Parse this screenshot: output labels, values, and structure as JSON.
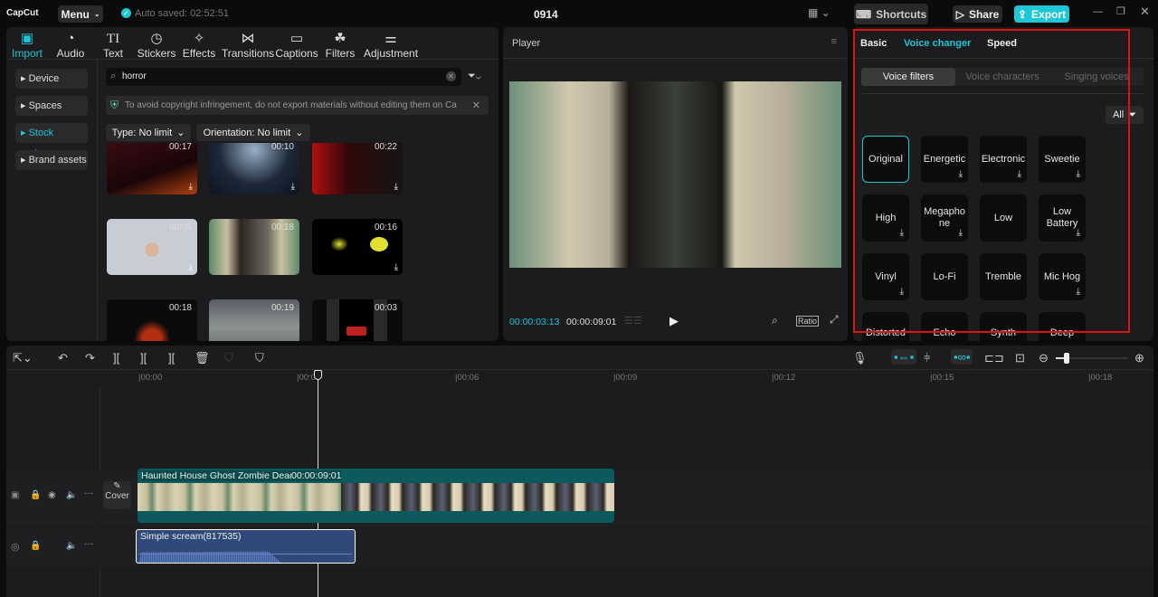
{
  "titlebar": {
    "logo": "CapCut",
    "menu": "Menu",
    "autosave": "Auto saved: 02:52:51",
    "project": "0914",
    "shortcuts": "Shortcuts",
    "share": "Share",
    "export": "Export"
  },
  "tabs": [
    {
      "label": "Import",
      "icon": "import-icon"
    },
    {
      "label": "Audio",
      "icon": "audio-icon"
    },
    {
      "label": "Text",
      "icon": "text-icon"
    },
    {
      "label": "Stickers",
      "icon": "stickers-icon"
    },
    {
      "label": "Effects",
      "icon": "effects-icon"
    },
    {
      "label": "Transitions",
      "icon": "transitions-icon"
    },
    {
      "label": "Captions",
      "icon": "captions-icon"
    },
    {
      "label": "Filters",
      "icon": "filters-icon"
    },
    {
      "label": "Adjustment",
      "icon": "adjustment-icon"
    }
  ],
  "sidebar": [
    {
      "label": "Device"
    },
    {
      "label": "Spaces"
    },
    {
      "label": "Stock mater..."
    },
    {
      "label": "Brand assets"
    }
  ],
  "search": {
    "value": "horror"
  },
  "notice": "To avoid copyright infringement, do not export materials without editing them on Ca",
  "filters": {
    "type": "Type: No limit",
    "orientation": "Orientation: No limit"
  },
  "media": [
    {
      "duration": "00:17"
    },
    {
      "duration": "00:10"
    },
    {
      "duration": "00:22"
    },
    {
      "duration": "00:09"
    },
    {
      "duration": "00:18"
    },
    {
      "duration": "00:16"
    },
    {
      "duration": "00:18"
    },
    {
      "duration": "00:19"
    },
    {
      "duration": "00:03"
    }
  ],
  "player": {
    "title": "Player",
    "current": "00:00:03:13",
    "total": "00:00:09:01",
    "ratio": "Ratio"
  },
  "right": {
    "tabs": [
      "Basic",
      "Voice changer",
      "Speed"
    ],
    "subtabs": [
      "Voice filters",
      "Voice characters",
      "Singing voices"
    ],
    "all": "All",
    "filters": [
      "Original",
      "Energetic",
      "Electronic",
      "Sweetie",
      "High",
      "Megaphone",
      "Low",
      "Low Battery",
      "Vinyl",
      "Lo-Fi",
      "Tremble",
      "Mic Hog",
      "Distorted",
      "Echo",
      "Synth",
      "Deep"
    ]
  },
  "timeline": {
    "ticks": [
      "00:00",
      "00:03",
      "00:06",
      "00:09",
      "00:12",
      "00:15",
      "00:18"
    ],
    "cover": "Cover",
    "video_clip": "Haunted House Ghost Zombie Dead",
    "video_duration": "00:00:09:01",
    "audio_clip": "Simple scream(817535)",
    "zoom_level": 0.15
  },
  "colors": {
    "accent": "#1ec6d6",
    "highlight": "#e01010"
  }
}
